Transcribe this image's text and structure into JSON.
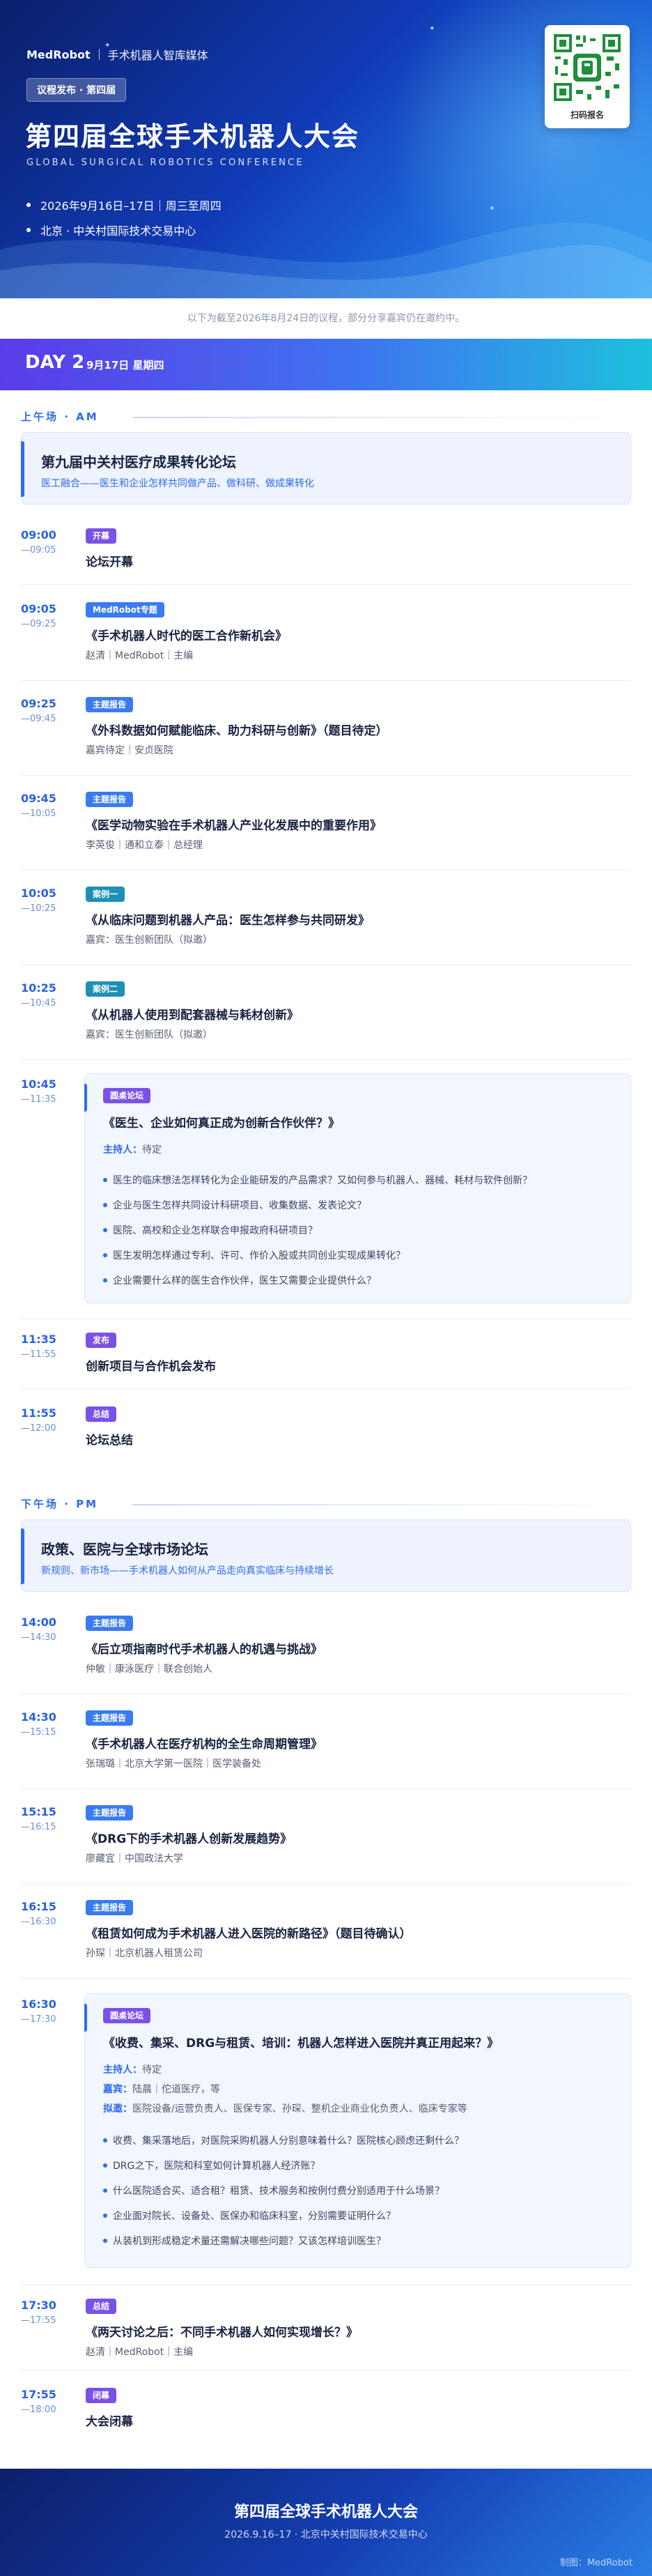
{
  "header": {
    "brand": "MedRobot",
    "brand_sub": "手术机器人智库媒体",
    "pill": "议程发布 · 第四届",
    "title": "第四届全球手术机器人大会",
    "subtitle_en": "GLOBAL SURGICAL ROBOTICS CONFERENCE",
    "date_line": "2026年9月16日–17日｜周三至周四",
    "location_line": "北京 · 中关村国际技术交易中心",
    "qr_label": "扫码报名"
  },
  "notice": "以下为截至2026年8月24日的议程，部分分享嘉宾仍在邀约中。",
  "day": {
    "label": "DAY 2",
    "date": "9月17日 星期四"
  },
  "am": {
    "section_label": "上午场 · AM",
    "forum_title": "第九届中关村医疗成果转化论坛",
    "forum_sub": "医工融合——医生和企业怎样共同做产品、做科研、做成果转化",
    "items": [
      {
        "start": "09:00",
        "end": "—09:05",
        "tag": "开幕",
        "title": "论坛开幕",
        "speaker": ""
      },
      {
        "start": "09:05",
        "end": "—09:25",
        "tag": "MedRobot专题",
        "title": "《手术机器人时代的医工合作新机会》",
        "speaker": "赵清｜MedRobot｜主编"
      },
      {
        "start": "09:25",
        "end": "—09:45",
        "tag": "主题报告",
        "title": "《外科数据如何赋能临床、助力科研与创新》（题目待定）",
        "speaker": "嘉宾待定｜安贞医院"
      },
      {
        "start": "09:45",
        "end": "—10:05",
        "tag": "主题报告",
        "title": "《医学动物实验在手术机器人产业化发展中的重要作用》",
        "speaker": "李英俊｜通和立泰｜总经理"
      },
      {
        "start": "10:05",
        "end": "—10:25",
        "tag": "案例一",
        "title": "《从临床问题到机器人产品：医生怎样参与共同研发》",
        "speaker": "嘉宾：医生创新团队（拟邀）"
      },
      {
        "start": "10:25",
        "end": "—10:45",
        "tag": "案例二",
        "title": "《从机器人使用到配套器械与耗材创新》",
        "speaker": "嘉宾：医生创新团队（拟邀）"
      }
    ],
    "panel": {
      "start": "10:45",
      "end": "—11:35",
      "tag": "圆桌论坛",
      "title": "《医生、企业如何真正成为创新合作伙伴？》",
      "host_label": "主持人：",
      "host": "待定",
      "questions": [
        "医生的临床想法怎样转化为企业能研发的产品需求？又如何参与机器人、器械、耗材与软件创新？",
        "企业与医生怎样共同设计科研项目、收集数据、发表论文？",
        "医院、高校和企业怎样联合申报政府科研项目？",
        "医生发明怎样通过专利、许可、作价入股或共同创业实现成果转化？",
        "企业需要什么样的医生合作伙伴，医生又需要企业提供什么？"
      ]
    },
    "tail": [
      {
        "start": "11:35",
        "end": "—11:55",
        "tag": "发布",
        "title": "创新项目与合作机会发布"
      },
      {
        "start": "11:55",
        "end": "—12:00",
        "tag": "总结",
        "title": "论坛总结"
      }
    ]
  },
  "pm": {
    "section_label": "下午场 · PM",
    "forum_title": "政策、医院与全球市场论坛",
    "forum_sub": "新规则、新市场——手术机器人如何从产品走向真实临床与持续增长",
    "items": [
      {
        "start": "14:00",
        "end": "—14:30",
        "tag": "主题报告",
        "title": "《后立项指南时代手术机器人的机遇与挑战》",
        "speaker": "仲敏｜康泳医疗｜联合创始人"
      },
      {
        "start": "14:30",
        "end": "—15:15",
        "tag": "主题报告",
        "title": "《手术机器人在医疗机构的全生命周期管理》",
        "speaker": "张瑞璐｜北京大学第一医院｜医学装备处"
      },
      {
        "start": "15:15",
        "end": "—16:15",
        "tag": "主题报告",
        "title": "《DRG下的手术机器人创新发展趋势》",
        "speaker": "廖藏宜｜中国政法大学"
      },
      {
        "start": "16:15",
        "end": "—16:30",
        "tag": "主题报告",
        "title": "《租赁如何成为手术机器人进入医院的新路径》（题目待确认）",
        "speaker": "孙琛｜北京机器人租赁公司"
      }
    ],
    "panel": {
      "start": "16:30",
      "end": "—17:30",
      "tag": "圆桌论坛",
      "title": "《收费、集采、DRG与租赁、培训：机器人怎样进入医院并真正用起来？》",
      "host_label": "主持人：",
      "host": "待定",
      "guests_label": "嘉宾：",
      "guests": "陆晨｜佗道医疗，等",
      "invite_label": "拟邀：",
      "invite": "医院设备/运营负责人、医保专家、孙琛、整机企业商业化负责人、临床专家等",
      "questions": [
        "收费、集采落地后，对医院采购机器人分别意味着什么？医院核心顾虑还剩什么？",
        "DRG之下，医院和科室如何计算机器人经济账？",
        "什么医院适合买、适合租？租赁、技术服务和按例付费分别适用于什么场景？",
        "企业面对院长、设备处、医保办和临床科室，分别需要证明什么？",
        "从装机到形成稳定术量还需解决哪些问题？又该怎样培训医生？"
      ]
    },
    "tail": [
      {
        "start": "17:30",
        "end": "—17:55",
        "tag": "总结",
        "title": "《两天讨论之后：不同手术机器人如何实现增长？》",
        "speaker": "赵清｜MedRobot｜主编"
      },
      {
        "start": "17:55",
        "end": "—18:00",
        "tag": "闭幕",
        "title": "大会闭幕",
        "speaker": ""
      }
    ]
  },
  "footer": {
    "title": "第四届全球手术机器人大会",
    "sub": "2026.9.16–17 · 北京中关村国际技术交易中心",
    "made_by": "制图：MedRobot"
  },
  "colors": {
    "accent": "#2e6bf0",
    "purple_tag": "#7a52e6",
    "teal_tag": "#1f8fb5",
    "hero_dark": "#0a1f6b"
  },
  "icons": [
    "qr-code-icon",
    "bullet-dot-icon"
  ]
}
